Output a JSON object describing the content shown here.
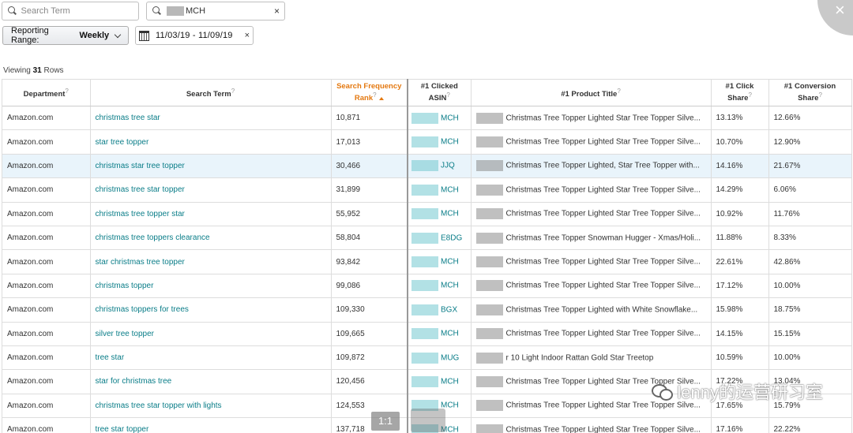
{
  "search": {
    "term_placeholder": "Search Term",
    "asin_value": "MCH"
  },
  "filters": {
    "range_label": "Reporting Range:",
    "range_value": "Weekly",
    "date_range": "11/03/19 - 11/09/19"
  },
  "viewing": {
    "prefix": "Viewing",
    "count": "31",
    "suffix": "Rows"
  },
  "table": {
    "headers": {
      "department": "Department",
      "search_term": "Search Term",
      "sfr": "Search Frequency Rank",
      "asin": "#1 Clicked ASIN",
      "title": "#1 Product Title",
      "click": "#1 Click Share",
      "conversion": "#1 Conversion Share"
    },
    "rows": [
      {
        "dept": "Amazon.com",
        "term": "christmas tree star",
        "rank": "10,871",
        "asin": "MCH",
        "title": "Christmas Tree Topper Lighted Star Tree Topper Silve...",
        "click": "13.13%",
        "conv": "12.66%"
      },
      {
        "dept": "Amazon.com",
        "term": "star tree topper",
        "rank": "17,013",
        "asin": "MCH",
        "title": "Christmas Tree Topper Lighted Star Tree Topper Silve...",
        "click": "10.70%",
        "conv": "12.90%"
      },
      {
        "dept": "Amazon.com",
        "term": "christmas star tree topper",
        "rank": "30,466",
        "asin": "JJQ",
        "title": "Christmas Tree Topper Lighted, Star Tree Topper with...",
        "click": "14.16%",
        "conv": "21.67%"
      },
      {
        "dept": "Amazon.com",
        "term": "christmas tree star topper",
        "rank": "31,899",
        "asin": "MCH",
        "title": "Christmas Tree Topper Lighted Star Tree Topper Silve...",
        "click": "14.29%",
        "conv": "6.06%"
      },
      {
        "dept": "Amazon.com",
        "term": "christmas tree topper star",
        "rank": "55,952",
        "asin": "MCH",
        "title": "Christmas Tree Topper Lighted Star Tree Topper Silve...",
        "click": "10.92%",
        "conv": "11.76%"
      },
      {
        "dept": "Amazon.com",
        "term": "christmas tree toppers clearance",
        "rank": "58,804",
        "asin": "E8DG",
        "title": "Christmas Tree Topper Snowman Hugger - Xmas/Holi...",
        "click": "11.88%",
        "conv": "8.33%"
      },
      {
        "dept": "Amazon.com",
        "term": "star christmas tree topper",
        "rank": "93,842",
        "asin": "MCH",
        "title": "Christmas Tree Topper Lighted Star Tree Topper Silve...",
        "click": "22.61%",
        "conv": "42.86%"
      },
      {
        "dept": "Amazon.com",
        "term": "christmas topper",
        "rank": "99,086",
        "asin": "MCH",
        "title": "Christmas Tree Topper Lighted Star Tree Topper Silve...",
        "click": "17.12%",
        "conv": "10.00%"
      },
      {
        "dept": "Amazon.com",
        "term": "christmas toppers for trees",
        "rank": "109,330",
        "asin": "BGX",
        "title": "Christmas Tree Topper Lighted with White Snowflake...",
        "click": "15.98%",
        "conv": "18.75%"
      },
      {
        "dept": "Amazon.com",
        "term": "silver tree topper",
        "rank": "109,665",
        "asin": "MCH",
        "title": "Christmas Tree Topper Lighted Star Tree Topper Silve...",
        "click": "14.15%",
        "conv": "15.15%"
      },
      {
        "dept": "Amazon.com",
        "term": "tree star",
        "rank": "109,872",
        "asin": "MUG",
        "title": "r 10 Light Indoor Rattan Gold Star Treetop",
        "click": "10.59%",
        "conv": "10.00%"
      },
      {
        "dept": "Amazon.com",
        "term": "star for christmas tree",
        "rank": "120,456",
        "asin": "MCH",
        "title": "Christmas Tree Topper Lighted Star Tree Topper Silve...",
        "click": "17.22%",
        "conv": "13.04%"
      },
      {
        "dept": "Amazon.com",
        "term": "christmas tree star topper with lights",
        "rank": "124,553",
        "asin": "MCH",
        "title": "Christmas Tree Topper Lighted Star Tree Topper Silve...",
        "click": "17.65%",
        "conv": "15.79%"
      },
      {
        "dept": "Amazon.com",
        "term": "tree star topper",
        "rank": "137,718",
        "asin": "MCH",
        "title": "Christmas Tree Topper Lighted Star Tree Topper Silve...",
        "click": "17.16%",
        "conv": "22.22%"
      }
    ]
  },
  "overlay": {
    "zoom_label": "1:1",
    "watermark": "lenny的运营研习室"
  }
}
